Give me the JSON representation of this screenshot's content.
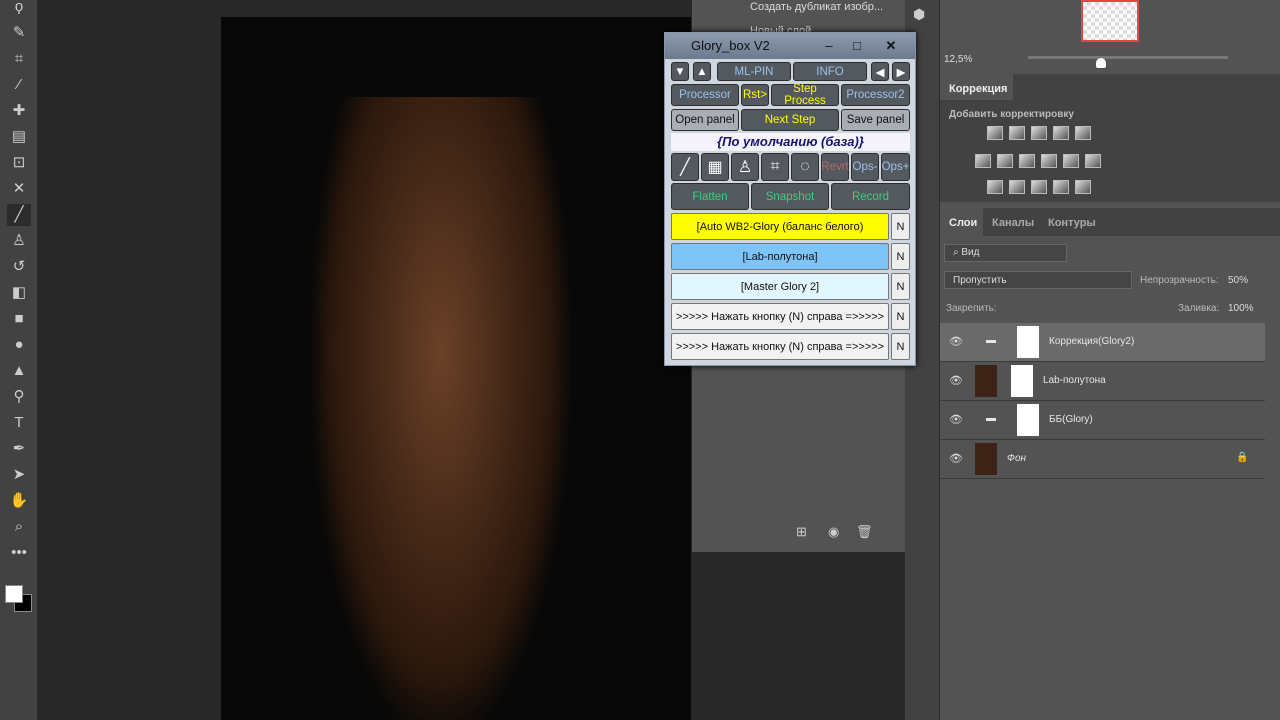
{
  "toolbar": {
    "tools": [
      "lasso-icon",
      "quick-select-icon",
      "crop-icon",
      "eyedropper-icon",
      "healing-icon",
      "patch-icon",
      "frame-icon",
      "move-content-icon",
      "brush-icon",
      "stamp-icon",
      "history-brush-icon",
      "eraser-icon",
      "gradient-icon",
      "blur-icon",
      "sharpen-icon",
      "dodge-icon",
      "type-icon",
      "pen-icon",
      "path-select-icon",
      "hand-icon",
      "zoom-icon",
      "more-icon"
    ]
  },
  "history": {
    "items": [
      "Создать дубликат изобр...",
      "Новый слой"
    ]
  },
  "navigator": {
    "zoom": "12,5%"
  },
  "adjustments": {
    "tab": "Коррекция",
    "add_label": "Добавить корректировку"
  },
  "layers_panel": {
    "tabs": [
      "Слои",
      "Каналы",
      "Контуры"
    ],
    "filter": "Вид",
    "blend_mode": "Пропустить",
    "opacity_label": "Непрозрачность:",
    "opacity": "50%",
    "lock_label": "Закрепить:",
    "fill_label": "Заливка:",
    "fill": "100%",
    "layers": [
      {
        "name": "Коррекция(Glory2)",
        "type": "group",
        "selected": true
      },
      {
        "name": "Lab-полутона",
        "type": "layer"
      },
      {
        "name": "ББ(Glory)",
        "type": "group"
      },
      {
        "name": "Фон",
        "type": "background",
        "locked": true
      }
    ]
  },
  "glory": {
    "title": "Glory_box V2",
    "ml_pin": "ML-PIN",
    "info": "INFO",
    "processor": "Processor",
    "rst": "Rst>",
    "step_process": "Step Process",
    "processor2": "Processor2",
    "open_panel": "Open panel",
    "next_step": "Next Step",
    "save_panel": "Save panel",
    "preset": "{По умолчанию (база)}",
    "revrt": "Revrt",
    "ops_minus": "Ops-",
    "ops_plus": "Ops+",
    "flatten": "Flatten",
    "snapshot": "Snapshot",
    "record": "Record",
    "actions": [
      {
        "label": "[Auto WB2-Glory (баланс белого)",
        "color": "#ffff00"
      },
      {
        "label": "[Lab-полутона]",
        "color": "#7fc4f8"
      },
      {
        "label": "[Master Glory 2]",
        "color": "#e2f6fd"
      },
      {
        "label": ">>>>> Нажать кнопку (N) справа =>>>>>",
        "color": "#f2f2f2"
      },
      {
        "label": ">>>>> Нажать кнопку (N) справа =>>>>>",
        "color": "#f2f2f2"
      }
    ],
    "n": "N"
  }
}
